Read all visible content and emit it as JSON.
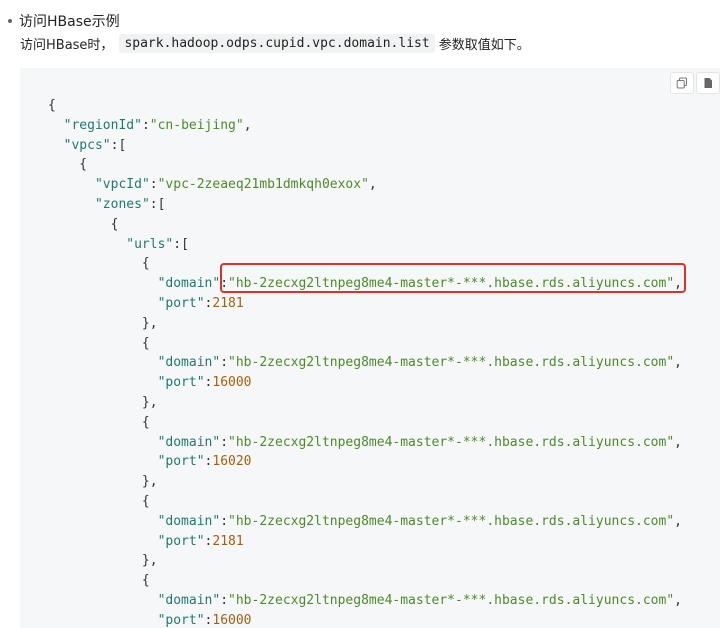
{
  "section": {
    "title": "访问HBase示例",
    "desc_prefix": "访问HBase时，",
    "code_key": "spark.hadoop.odps.cupid.vpc.domain.list",
    "desc_suffix": "参数取值如下。"
  },
  "toolbar": {
    "icons": [
      "copy-icon",
      "file-icon"
    ]
  },
  "code": {
    "region_key": "regionId",
    "region_value": "cn-beijing",
    "vpcs_key": "vpcs",
    "vpcid_key": "vpcId",
    "vpcid_value": "vpc-2zeaeq21mb1dmkqh0exox",
    "zones_key": "zones",
    "urls_key": "urls",
    "domain_key": "domain",
    "port_key": "port",
    "entries": [
      {
        "domain": "hb-2zecxg2ltnpeg8me4-master*-***.hbase.rds.aliyuncs.com",
        "port": "2181"
      },
      {
        "domain": "hb-2zecxg2ltnpeg8me4-master*-***.hbase.rds.aliyuncs.com",
        "port": "16000"
      },
      {
        "domain": "hb-2zecxg2ltnpeg8me4-master*-***.hbase.rds.aliyuncs.com",
        "port": "16020"
      },
      {
        "domain": "hb-2zecxg2ltnpeg8me4-master*-***.hbase.rds.aliyuncs.com",
        "port": "2181"
      },
      {
        "domain": "hb-2zecxg2ltnpeg8me4-master*-***.hbase.rds.aliyuncs.com",
        "port": "16000"
      }
    ]
  }
}
